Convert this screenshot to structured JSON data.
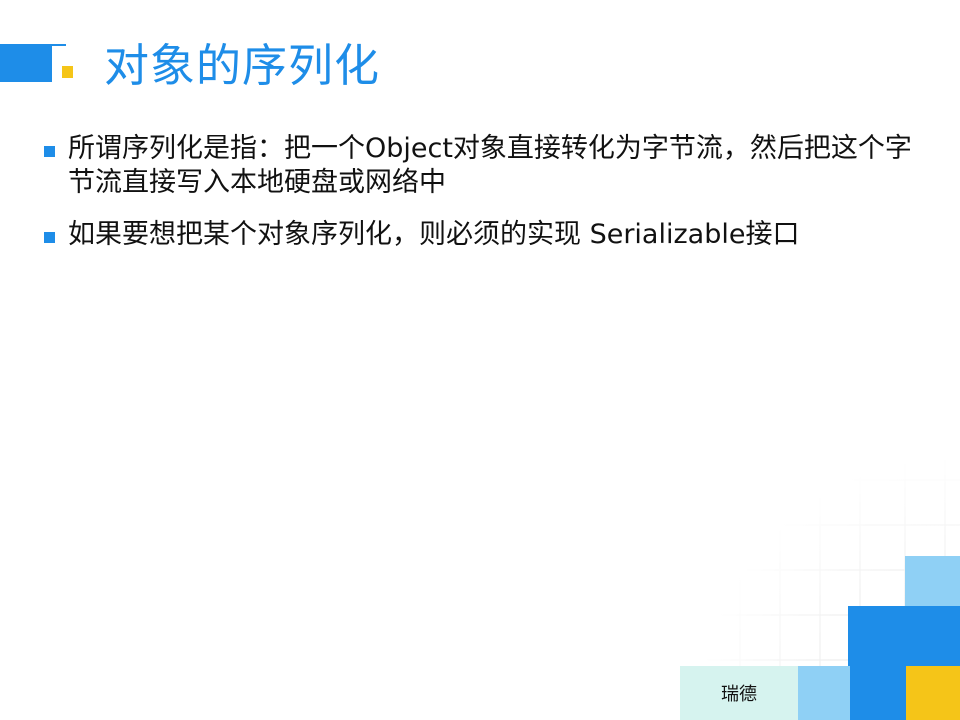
{
  "title": "对象的序列化",
  "bullets": [
    "所谓序列化是指：把一个Object对象直接转化为字节流，然后把这个字节流直接写入本地硬盘或网络中",
    "如果要想把某个对象序列化，则必须的实现 Serializable接口"
  ],
  "footer": {
    "label": "瑞德"
  },
  "colors": {
    "accent_blue": "#1e8de8",
    "accent_yellow": "#f5c518",
    "footer_bg": "#d6f3ef"
  }
}
